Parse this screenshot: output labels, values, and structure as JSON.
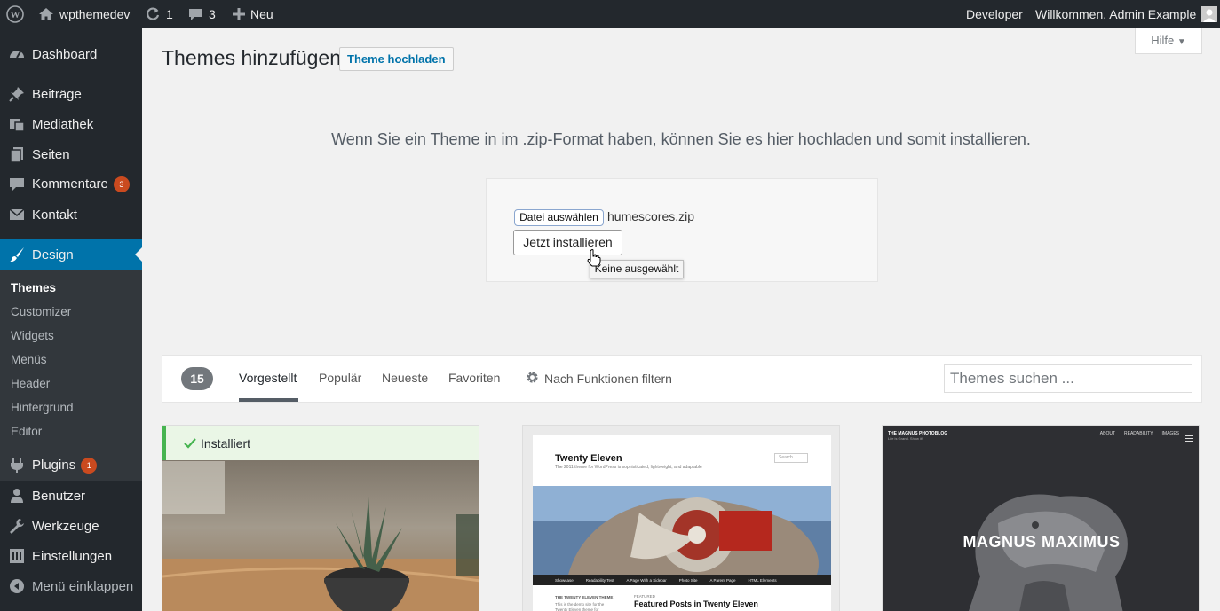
{
  "adminbar": {
    "site_name": "wpthemedev",
    "updates_count": "1",
    "comments_count": "3",
    "new_label": "Neu",
    "developer_label": "Developer",
    "welcome": "Willkommen, Admin Example"
  },
  "sidebar": {
    "items": [
      {
        "label": "Dashboard",
        "icon": "dashboard-icon"
      },
      {
        "label": "Beiträge",
        "icon": "pin-icon"
      },
      {
        "label": "Mediathek",
        "icon": "media-icon"
      },
      {
        "label": "Seiten",
        "icon": "pages-icon"
      },
      {
        "label": "Kommentare",
        "icon": "comments-icon",
        "badge": "3"
      },
      {
        "label": "Kontakt",
        "icon": "mail-icon"
      },
      {
        "label": "Design",
        "icon": "brush-icon"
      },
      {
        "label": "Plugins",
        "icon": "plugin-icon",
        "badge": "1"
      },
      {
        "label": "Benutzer",
        "icon": "users-icon"
      },
      {
        "label": "Werkzeuge",
        "icon": "wrench-icon"
      },
      {
        "label": "Einstellungen",
        "icon": "settings-icon"
      },
      {
        "label": "Menü einklappen",
        "icon": "collapse-icon"
      }
    ],
    "submenu": [
      "Themes",
      "Customizer",
      "Widgets",
      "Menüs",
      "Header",
      "Hintergrund",
      "Editor"
    ]
  },
  "page": {
    "title": "Themes hinzufügen",
    "upload_button": "Theme hochladen",
    "help_tab": "Hilfe",
    "upload_description": "Wenn Sie ein Theme in im .zip-Format haben, können Sie es hier hochladen und somit installieren.",
    "file_button": "Datei auswählen",
    "file_name": "humescores.zip",
    "install_button": "Jetzt installieren",
    "tooltip": "Keine ausgewählt"
  },
  "filter": {
    "count": "15",
    "tabs": [
      "Vorgestellt",
      "Populär",
      "Neueste",
      "Favoriten"
    ],
    "feature_filter": "Nach Funktionen filtern",
    "search_placeholder": "Themes suchen ..."
  },
  "themes": {
    "installed_label": "Installiert",
    "twenty_eleven": {
      "title": "Twenty Eleven",
      "tagline": "The 2011 theme for WordPress is sophisticated, lightweight, and adaptable",
      "search": "Search",
      "nav": [
        "Showcase",
        "Readability Test",
        "A Page With a Sidebar",
        "Photo Site",
        "A Parent Page",
        "HTML Elements"
      ],
      "side_heading": "THE TWENTY ELEVEN THEME",
      "side_text": "This is the demo site for the Twenty Eleven theme for",
      "featured_label": "FEATURED",
      "featured_title": "Featured Posts in Twenty Eleven"
    },
    "magnus": {
      "brand": "THE MAGNUS PHOTOBLOG",
      "brand_sub": "Life is Grand. Show it!",
      "nav": [
        "ABOUT",
        "READABILITY",
        "IMAGES"
      ],
      "title": "MAGNUS MAXIMUS"
    }
  },
  "colors": {
    "adminbar_bg": "#23282d",
    "accent": "#0073aa",
    "badge": "#ca4a1f",
    "installed_green": "#46b450"
  }
}
